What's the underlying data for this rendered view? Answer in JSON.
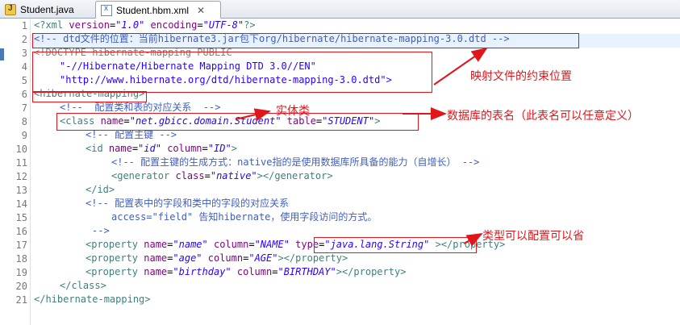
{
  "tabs": [
    {
      "label": "Student.java",
      "icon": "java-file-icon"
    },
    {
      "label": "Student.hbm.xml",
      "icon": "xml-file-icon",
      "close": "✕"
    }
  ],
  "line_numbers": [
    "1",
    "2",
    "3",
    "4",
    "5",
    "6",
    "7",
    "8",
    "9",
    "10",
    "11",
    "12",
    "13",
    "14",
    "15",
    "16",
    "17",
    "18",
    "19",
    "20",
    "21"
  ],
  "code": {
    "l1": {
      "p1": "<?xml ",
      "a1": "version",
      "eq1": "=",
      "v1": "\"1.0\"",
      "sp": " ",
      "a2": "encoding",
      "eq2": "=",
      "v2": "\"UTF-8\"",
      "end": "?>"
    },
    "l2": "<!-- dtd文件的位置：当前hibernate3.jar包下org/hibernate/hibernate-mapping-3.0.dtd -->",
    "l3": "<!DOCTYPE hibernate-mapping PUBLIC",
    "l4": "\"-//Hibernate/Hibernate Mapping DTD 3.0//EN\"",
    "l5": "\"http://www.hibernate.org/dtd/hibernate-mapping-3.0.dtd\">",
    "l6": "<hibernate-mapping>",
    "l7": "<!--  配置类和表的对应关系  -->",
    "l8": {
      "open": "<class ",
      "a1": "name",
      "v1": "\"net.gbicc.domain.Student\"",
      "a2": "table",
      "v2": "\"STUDENT\"",
      "end": ">"
    },
    "l9": "<!-- 配置主键 -->",
    "l10": {
      "open": "<id ",
      "a1": "name",
      "v1": "\"id\"",
      "a2": "column",
      "v2": "\"ID\"",
      "end": ">"
    },
    "l11": "<!-- 配置主键的生成方式：native指的是使用数据库所具备的能力（自增长） -->",
    "l12": {
      "open": "<generator ",
      "a1": "class",
      "v1": "\"native\"",
      "end": "></generator>"
    },
    "l13": "</id>",
    "l14": "<!-- 配置表中的字段和类中的字段的对应关系",
    "l15": "access=\"field\" 告知hibernate，使用字段访问的方式。",
    "l16": "-->",
    "l17": {
      "open": "<property ",
      "a1": "name",
      "v1": "\"name\"",
      "a2": "column",
      "v2": "\"NAME\"",
      "a3": "type",
      "v3": "\"java.lang.String\"",
      "end": "></property>"
    },
    "l18": {
      "open": "<property ",
      "a1": "name",
      "v1": "\"age\"",
      "a2": "column",
      "v2": "\"AGE\"",
      "end": "></property>"
    },
    "l19": {
      "open": "<property ",
      "a1": "name",
      "v1": "\"birthday\"",
      "a2": "column",
      "v2": "\"BIRTHDAY\"",
      "end": "></property>"
    },
    "l20": "</class>",
    "l21": "</hibernate-mapping>"
  },
  "annotations": {
    "constraint_location": "映射文件的约束位置",
    "entity_class": "实体类",
    "table_name": "数据库的表名（此表名可以任意定义）",
    "type_optional": "类型可以配置可以省"
  },
  "colors": {
    "annotation": "#e0161b",
    "current_line": "#e8f2fe",
    "comment": "#3f5fbf",
    "tag": "#3f7f7f"
  }
}
